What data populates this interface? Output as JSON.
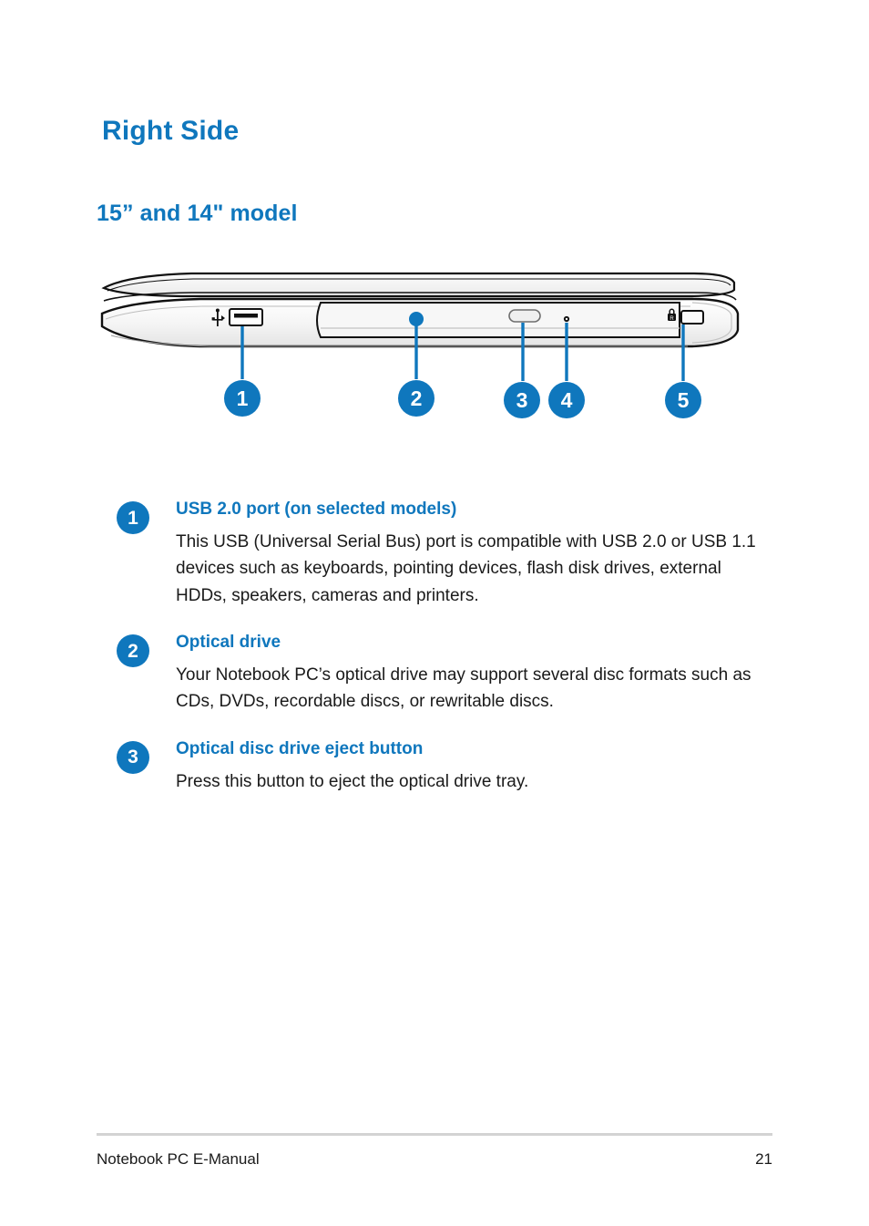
{
  "document": {
    "section_title": "Right Side",
    "sub_title": "15” and 14\" model"
  },
  "figure": {
    "alt_label": "Right side view of Notebook PC",
    "callouts": [
      {
        "number": "1",
        "target": "usb-2-port"
      },
      {
        "number": "2",
        "target": "optical-drive"
      },
      {
        "number": "3",
        "target": "optical-disc-drive-eject-button"
      },
      {
        "number": "4",
        "target": "optical-disc-drive-manual-eject-hole"
      },
      {
        "number": "5",
        "target": "kensington-security-slot"
      }
    ],
    "ports": [
      {
        "name": "usb-port-icon",
        "label": "USB"
      },
      {
        "name": "optical-drive-tray",
        "label": "Optical drive"
      },
      {
        "name": "eject-button",
        "label": "Eject"
      },
      {
        "name": "pinhole",
        "label": "Manual eject hole"
      },
      {
        "name": "kensington-lock-icon",
        "label": "Kensington lock"
      }
    ]
  },
  "features": [
    {
      "number": "1",
      "title": "USB 2.0 port (on selected models)",
      "body": "This USB (Universal Serial Bus) port is compatible with USB 2.0 or USB 1.1 devices such as keyboards, pointing devices, flash disk drives, external HDDs, speakers, cameras and printers."
    },
    {
      "number": "2",
      "title": "Optical drive",
      "body": "Your Notebook PC’s optical drive may support several disc formats such as CDs, DVDs, recordable discs, or rewritable discs."
    },
    {
      "number": "3",
      "title": "Optical disc drive eject button",
      "body": "Press this button to eject the optical drive tray."
    }
  ],
  "footer": {
    "left": "Notebook PC E-Manual",
    "page_number": "21"
  },
  "colors": {
    "accent_blue": "#0f77bd",
    "text": "#1a1a1a",
    "rule": "#d3d3d3"
  }
}
